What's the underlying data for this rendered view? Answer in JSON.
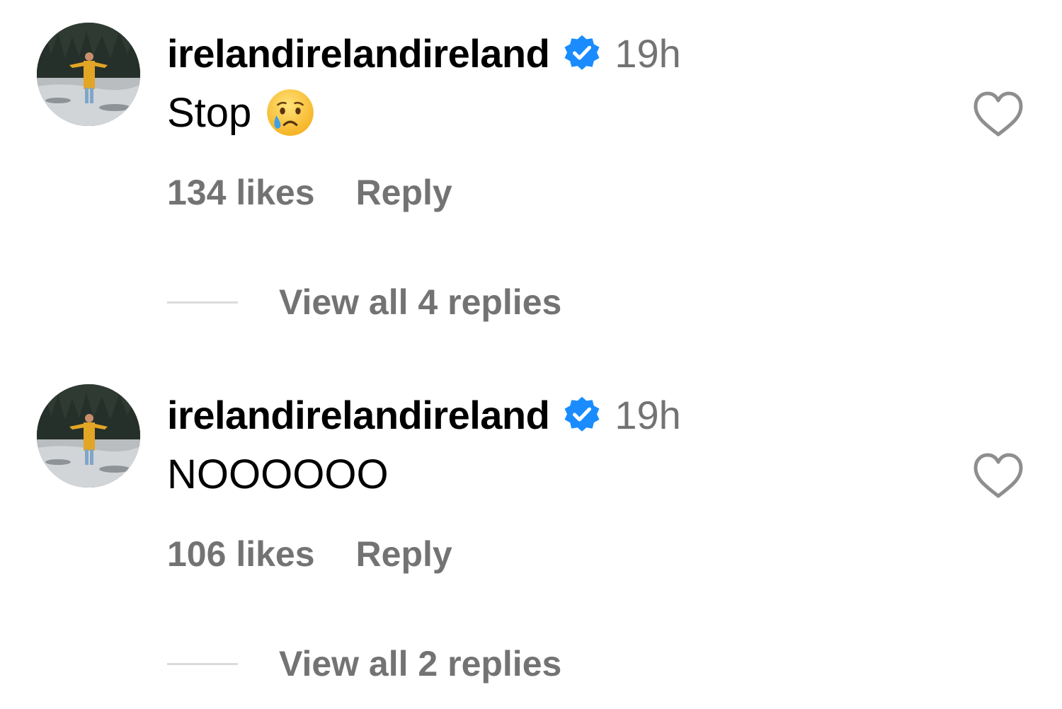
{
  "comments": [
    {
      "username": "irelandirelandireland",
      "verified": true,
      "time": "19h",
      "text": "Stop",
      "emoji": "crying-face",
      "likes": "134 likes",
      "reply_label": "Reply",
      "view_replies": "View all 4 replies"
    },
    {
      "username": "irelandirelandireland",
      "verified": true,
      "time": "19h",
      "text": "NOOOOOO",
      "likes": "106 likes",
      "reply_label": "Reply",
      "view_replies": "View all 2 replies"
    }
  ],
  "colors": {
    "verified_badge": "#1a8cff",
    "secondary_text": "#737373",
    "divider": "#dbdbdb"
  }
}
